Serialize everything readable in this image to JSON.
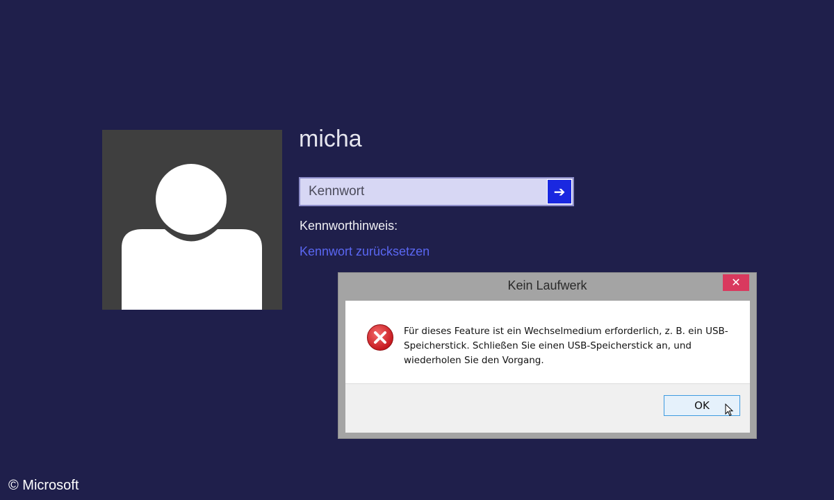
{
  "user": {
    "name": "micha"
  },
  "login": {
    "password_placeholder": "Kennwort",
    "submit_glyph": "➔",
    "hint_label": "Kennworthinweis:",
    "reset_link": "Kennwort zurücksetzen",
    "accent_color": "#1a28e0"
  },
  "dialog": {
    "title": "Kein Laufwerk",
    "close_glyph": "✕",
    "message": "Für dieses Feature ist ein Wechselmedium erforderlich, z. B. ein USB-Speicherstick. Schließen Sie einen USB-Speicherstick an, und wiederholen Sie den Vorgang.",
    "icon": "error-icon",
    "ok_label": "OK"
  },
  "footer": {
    "copyright": "© Microsoft"
  }
}
